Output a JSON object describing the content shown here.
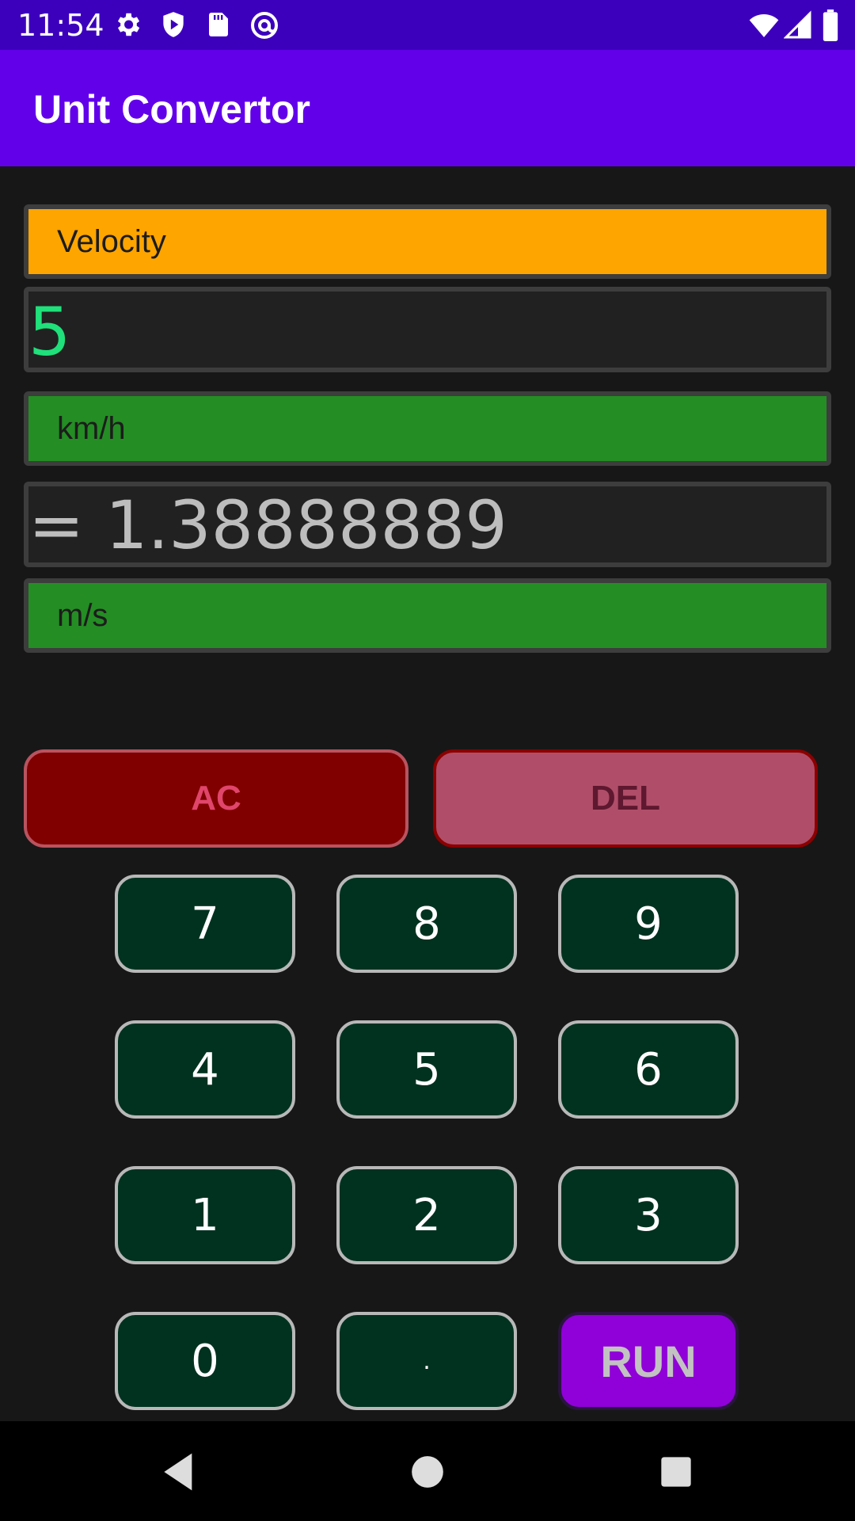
{
  "status_bar": {
    "time": "11:54",
    "left_icons": [
      "gear-icon",
      "shield-play-icon",
      "sd-card-icon",
      "at-sign-icon"
    ],
    "right_icons": [
      "wifi-icon",
      "signal-icon",
      "battery-icon"
    ]
  },
  "app_bar": {
    "title": "Unit Convertor",
    "color": "#6200ea"
  },
  "converter": {
    "category": "Velocity",
    "input_value": "5",
    "from_unit": "km/h",
    "result": "= 1.38888889",
    "to_unit": "m/s"
  },
  "buttons": {
    "ac": "AC",
    "del": "DEL",
    "keys": [
      "7",
      "8",
      "9",
      "4",
      "5",
      "6",
      "1",
      "2",
      "3",
      "0",
      ".",
      "RUN"
    ]
  },
  "nav_bar": {
    "icons": [
      "back-icon",
      "home-icon",
      "recents-icon"
    ]
  },
  "colors": {
    "category_bg": "#ffa500",
    "unit_bg": "#248d24",
    "key_bg": "#013220",
    "run_bg": "#9000d8",
    "ac_bg": "#800000",
    "del_bg": "#b04e69"
  }
}
